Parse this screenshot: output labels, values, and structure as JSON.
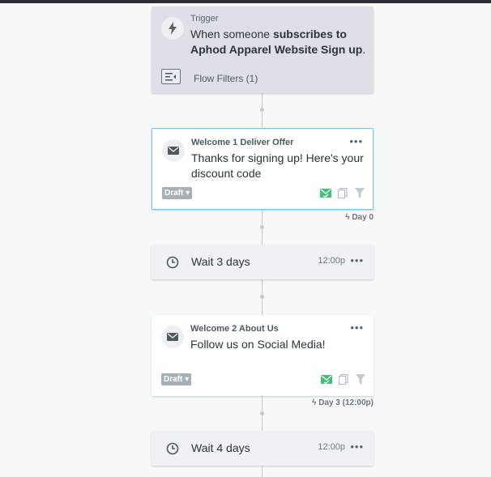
{
  "trigger": {
    "label": "Trigger",
    "text_prefix": "When someone ",
    "text_bold_1": "subscribes to",
    "text_bold_2": "Aphod Apparel Website Sign up",
    "text_suffix": ".",
    "filter_label": "Flow Filters (1)"
  },
  "steps": [
    {
      "title": "Welcome 1 Deliver Offer",
      "subject": "Thanks for signing up! Here's your discount code",
      "status": "Draft",
      "day_label": "Day 0"
    },
    {
      "label": "Wait 3 days",
      "time": "12:00p"
    },
    {
      "title": "Welcome 2 About Us",
      "subject": "Follow us on Social Media!",
      "status": "Draft",
      "day_label": "Day 3 (12:00p)"
    },
    {
      "label": "Wait 4 days",
      "time": "12:00p"
    }
  ],
  "ui": {
    "more_glyph": "•••",
    "draft_caret": "▾",
    "bolt_glyph": "ϟ"
  },
  "colors": {
    "selected_border": "#7ec3e9",
    "status_green": "#3fbf7a",
    "trigger_bg": "#dde1e7",
    "draft_badge": "#a8b0b5"
  }
}
